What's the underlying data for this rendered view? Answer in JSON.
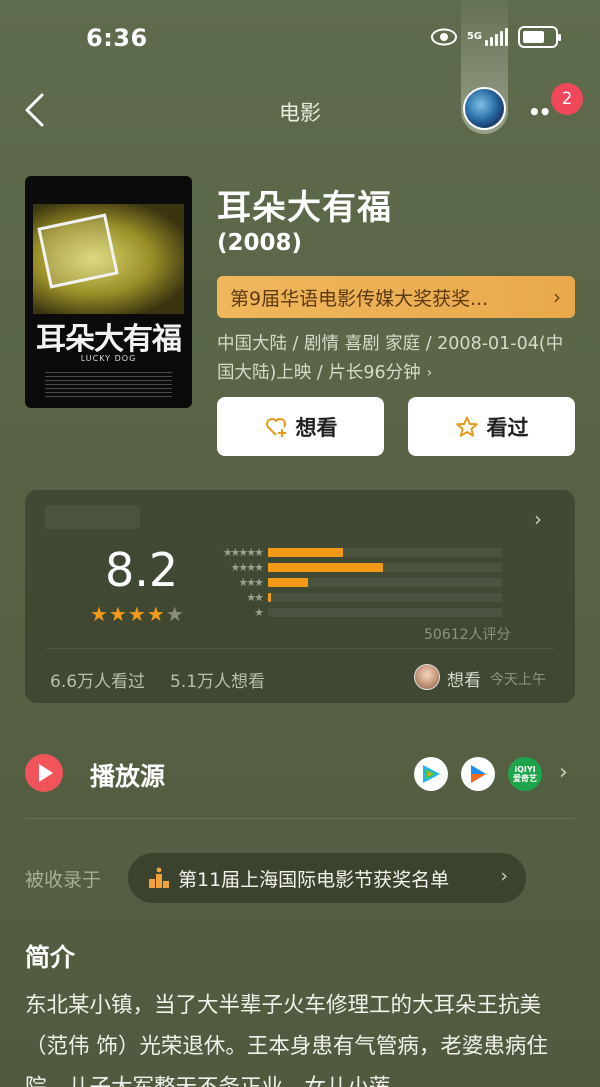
{
  "status_bar": {
    "time": "6:36",
    "network": "5G"
  },
  "nav": {
    "title": "电影",
    "notification_count": "2"
  },
  "movie": {
    "poster_title": "耳朵大有福",
    "poster_subtitle": "LUCKY DOG",
    "title": "耳朵大有福",
    "year": "(2008)",
    "award_banner": "第9届华语电影传媒大奖获奖...",
    "meta_line1": "中国大陆 / 剧情 喜剧 家庭 / 2008-01-04(中",
    "meta_line2": "国大陆)上映 / 片长96分钟",
    "want_label": "想看",
    "seen_label": "看过"
  },
  "rating": {
    "score": "8.2",
    "stars": 4,
    "distribution": [
      {
        "stars": 5,
        "fraction": 0.32
      },
      {
        "stars": 4,
        "fraction": 0.49
      },
      {
        "stars": 3,
        "fraction": 0.17
      },
      {
        "stars": 2,
        "fraction": 0.01
      },
      {
        "stars": 1,
        "fraction": 0.0
      }
    ],
    "count_text": "50612人评分",
    "seen_text": "6.6万人看过",
    "want_text": "5.1万人想看",
    "user_action": "想看",
    "user_time": "今天上午"
  },
  "play_source": {
    "title": "播放源",
    "sources": [
      "tencent-video-icon",
      "youku-icon",
      "iqiyi-icon"
    ],
    "iqiyi_label": "iQIYI\n爱奇艺"
  },
  "collected": {
    "label": "被收录于",
    "list_name": "第11届上海国际电影节获奖名单"
  },
  "intro": {
    "title": "简介",
    "text": "东北某小镇，当了大半辈子火车修理工的大耳朵王抗美（范伟 饰）光荣退休。王本身患有气管病，老婆患病住院，儿子大军整天不务正业，女儿小莲"
  },
  "colors": {
    "accent_orange": "#f39a18",
    "award_bg": "#f0b75c",
    "badge_red": "#f0475a",
    "play_red": "#f2545c"
  }
}
